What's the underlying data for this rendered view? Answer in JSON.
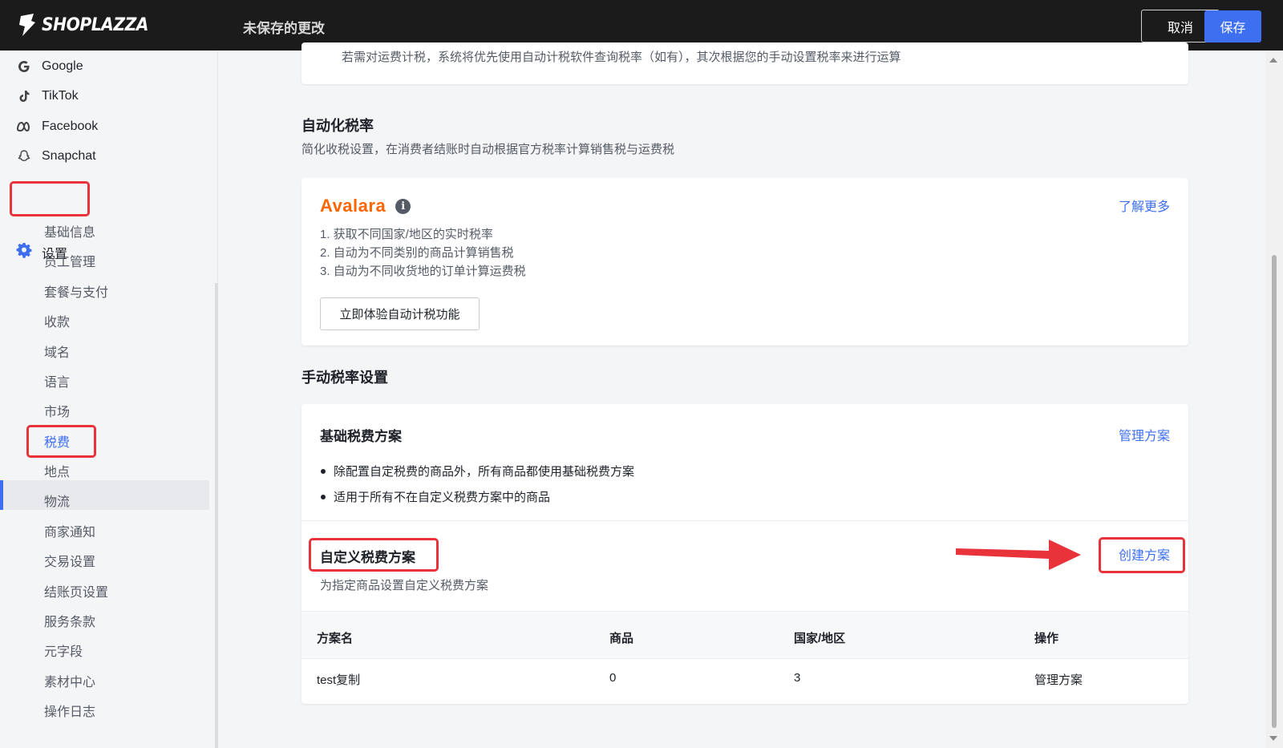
{
  "header": {
    "brand": "SHOPLAZZA",
    "unsaved_text": "未保存的更改",
    "cancel_label": "取消",
    "save_label": "保存"
  },
  "sidebar": {
    "apps": [
      {
        "label": "Google",
        "icon": "google-icon"
      },
      {
        "label": "TikTok",
        "icon": "tiktok-icon"
      },
      {
        "label": "Facebook",
        "icon": "meta-icon"
      },
      {
        "label": "Snapchat",
        "icon": "snapchat-icon"
      }
    ],
    "settings_label": "设置",
    "settings_icon": "gear-icon",
    "sub_items": [
      "基础信息",
      "员工管理",
      "套餐与支付",
      "收款",
      "域名",
      "语言",
      "市场",
      "税费",
      "地点",
      "物流",
      "商家通知",
      "交易设置",
      "结账页设置",
      "服务条款",
      "元字段",
      "素材中心",
      "操作日志"
    ],
    "active_sub_item": "税费"
  },
  "main": {
    "top_note": "若需对运费计税，系统将优先使用自动计税软件查询税率（如有），其次根据您的手动设置税率来进行运算",
    "auto_tax": {
      "title": "自动化税率",
      "subtitle": "简化收税设置，在消费者结账时自动根据官方税率计算销售税与运费税",
      "provider": "Avalara",
      "learn_more": "了解更多",
      "features": [
        "1. 获取不同国家/地区的实时税率",
        "2. 自动为不同类别的商品计算销售税",
        "3. 自动为不同收货地的订单计算运费税"
      ],
      "try_button": "立即体验自动计税功能"
    },
    "manual_tax": {
      "title": "手动税率设置",
      "base_plan": {
        "title": "基础税费方案",
        "manage_link": "管理方案",
        "bullets": [
          "除配置自定税费的商品外，所有商品都使用基础税费方案",
          "适用于所有不在自定义税费方案中的商品"
        ]
      },
      "custom_plan": {
        "title": "自定义税费方案",
        "subtitle": "为指定商品设置自定义税费方案",
        "create_link": "创建方案"
      },
      "table": {
        "headers": [
          "方案名",
          "商品",
          "国家/地区",
          "操作"
        ],
        "rows": [
          {
            "name": "test复制",
            "products": "0",
            "regions": "3",
            "action": "管理方案"
          }
        ]
      }
    }
  },
  "colors": {
    "accent": "#3d6ff0",
    "highlight_red": "#e8333a",
    "topbar": "#1b1b1b",
    "avalara_orange": "#ff6600"
  }
}
